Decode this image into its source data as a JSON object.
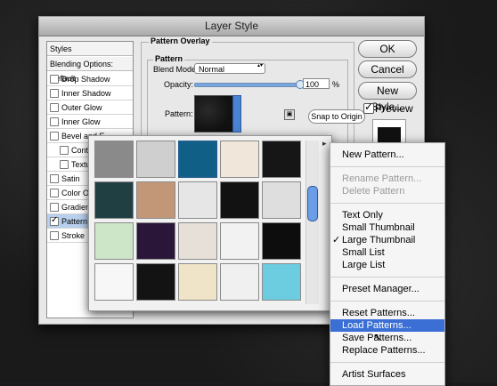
{
  "window": {
    "title": "Layer Style"
  },
  "styles_panel": {
    "header": "Styles",
    "blending": "Blending Options: Default",
    "items": [
      {
        "label": "Drop Shadow",
        "checked": false
      },
      {
        "label": "Inner Shadow",
        "checked": false
      },
      {
        "label": "Outer Glow",
        "checked": false
      },
      {
        "label": "Inner Glow",
        "checked": false
      },
      {
        "label": "Bevel and E",
        "checked": false
      },
      {
        "label": "Contour",
        "checked": false
      },
      {
        "label": "Texture",
        "checked": false
      },
      {
        "label": "Satin",
        "checked": false
      },
      {
        "label": "Color Over",
        "checked": false
      },
      {
        "label": "Gradient O",
        "checked": false
      },
      {
        "label": "Pattern Ov",
        "checked": true,
        "selected": true
      },
      {
        "label": "Stroke",
        "checked": false
      }
    ]
  },
  "pattern_overlay": {
    "group_title": "Pattern Overlay",
    "subgroup_title": "Pattern",
    "blend_mode_label": "Blend Mode:",
    "blend_mode_value": "Normal",
    "opacity_label": "Opacity:",
    "opacity_value": "100",
    "opacity_unit": "%",
    "opacity_fraction": 1.0,
    "pattern_label": "Pattern:",
    "snap_button": "Snap to Origin"
  },
  "buttons": {
    "ok": "OK",
    "cancel": "Cancel",
    "new_style": "New Style...",
    "preview": "Preview"
  },
  "picker": {
    "menu_icon": "arrow-right-icon",
    "swatches": [
      [
        "#8a8a8a",
        "#cfcfcf",
        "#0f5f86",
        "#f1e6da",
        "#161616"
      ],
      [
        "#1f3f42",
        "#c29778",
        "#e6e6e6",
        "#121212",
        "#dedede"
      ],
      [
        "#cde6c8",
        "#2a1638",
        "#e6e0d8",
        "#f2f2f2",
        "#0d0d0d"
      ],
      [
        "#f7f7f7",
        "#131313",
        "#efe3c8",
        "#f0f0f0",
        "#6ccde0"
      ]
    ]
  },
  "menu": {
    "items": [
      {
        "label": "New Pattern...",
        "disabled": false
      },
      {
        "label": "Rename Pattern...",
        "disabled": true
      },
      {
        "label": "Delete Pattern",
        "disabled": true
      },
      {
        "label": "Text Only",
        "disabled": false
      },
      {
        "label": "Small Thumbnail",
        "disabled": false
      },
      {
        "label": "Large Thumbnail",
        "disabled": false,
        "checked": true
      },
      {
        "label": "Small List",
        "disabled": false
      },
      {
        "label": "Large List",
        "disabled": false
      },
      {
        "label": "Preset Manager...",
        "disabled": false
      },
      {
        "label": "Reset Patterns...",
        "disabled": false
      },
      {
        "label": "Load Patterns...",
        "disabled": false,
        "highlighted": true
      },
      {
        "label": "Save Patterns...",
        "disabled": false
      },
      {
        "label": "Replace Patterns...",
        "disabled": false
      },
      {
        "label": "Artist Surfaces",
        "disabled": false
      }
    ]
  }
}
